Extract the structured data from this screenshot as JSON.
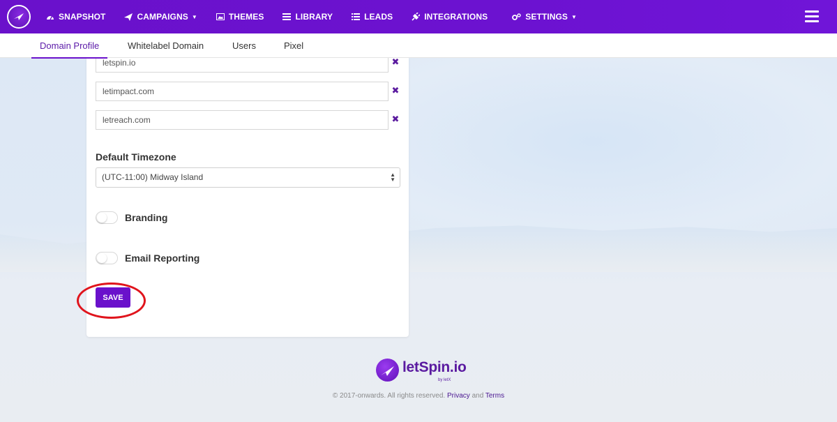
{
  "navbar": {
    "items": [
      {
        "label": "SNAPSHOT",
        "icon": "dashboard-icon"
      },
      {
        "label": "CAMPAIGNS",
        "icon": "paper-plane-icon",
        "dropdown": true
      },
      {
        "label": "THEMES",
        "icon": "image-icon"
      },
      {
        "label": "LIBRARY",
        "icon": "list-alt-icon"
      },
      {
        "label": "LEADS",
        "icon": "list-icon"
      },
      {
        "label": "INTEGRATIONS",
        "icon": "plug-icon"
      },
      {
        "label": "SETTINGS",
        "icon": "cogs-icon",
        "dropdown": true
      }
    ],
    "menu_icon": "hamburger-icon"
  },
  "subnav": {
    "tabs": [
      {
        "label": "Domain Profile",
        "active": true
      },
      {
        "label": "Whitelabel Domain",
        "active": false
      },
      {
        "label": "Users",
        "active": false
      },
      {
        "label": "Pixel",
        "active": false
      }
    ]
  },
  "domains": {
    "values": [
      "letspin.io",
      "letimpact.com",
      "letreach.com"
    ],
    "remove_icon": "times-icon"
  },
  "timezone": {
    "label": "Default Timezone",
    "selected": "(UTC-11:00) Midway Island"
  },
  "toggles": {
    "branding": {
      "label": "Branding",
      "on": false
    },
    "email_reporting": {
      "label": "Email Reporting",
      "on": false
    }
  },
  "save_label": "SAVE",
  "footer": {
    "brand": "letSpin.io",
    "byline": "by letX",
    "copyright": "© 2017-onwards. All rights reserved.",
    "privacy": "Privacy",
    "and": "and",
    "terms": "Terms"
  },
  "colors": {
    "primary": "#6a11cb",
    "highlight": "#e0141c"
  }
}
